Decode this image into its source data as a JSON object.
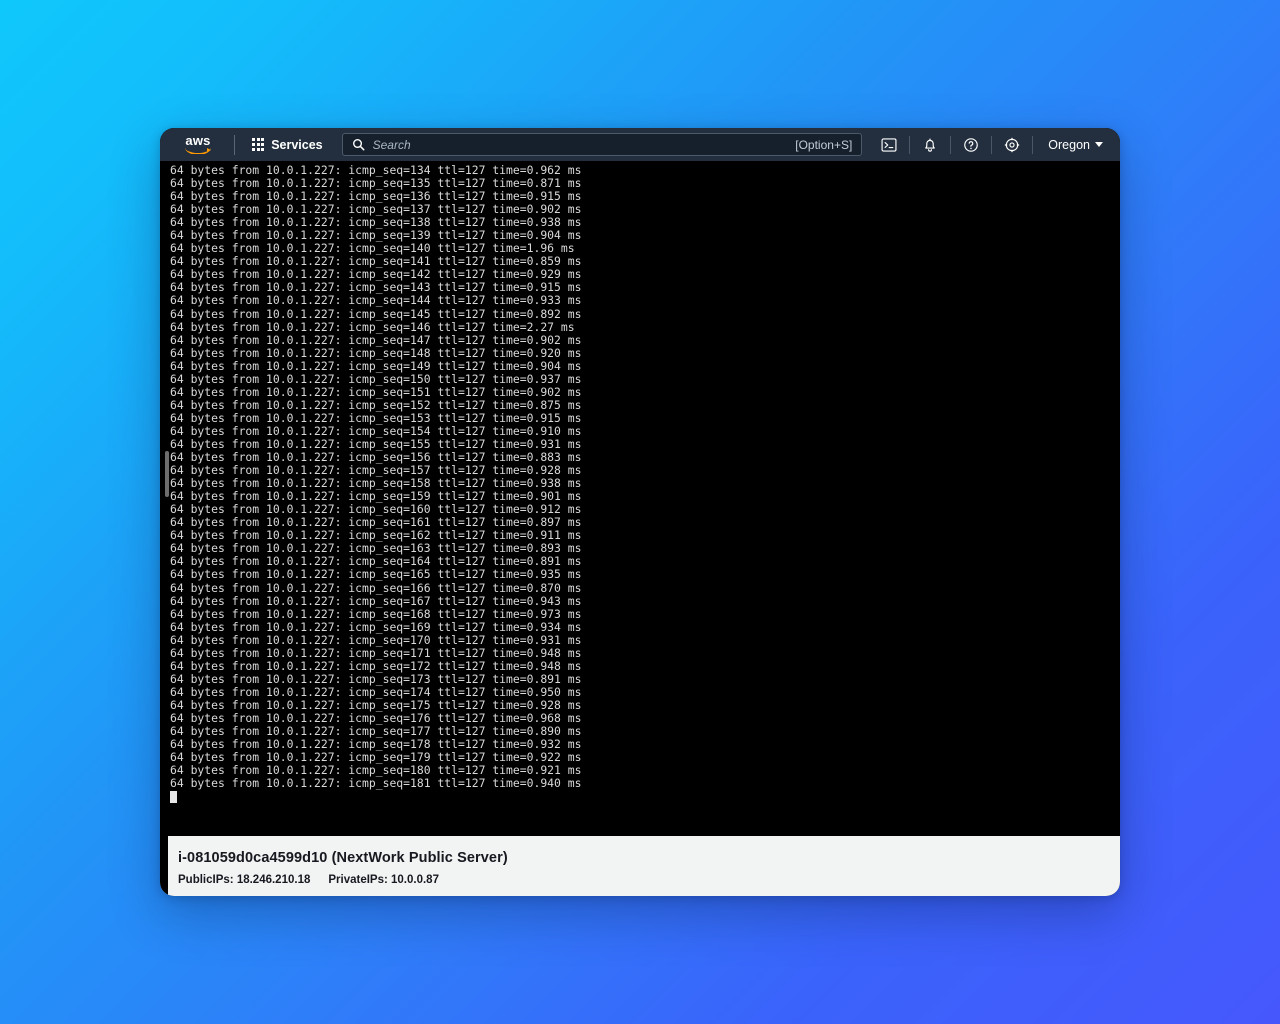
{
  "topnav": {
    "logo_text": "aws",
    "services_label": "Services",
    "search": {
      "placeholder": "Search",
      "value": "",
      "shortcut": "[Option+S]"
    },
    "icons": [
      {
        "name": "cloudshell-icon",
        "title": "CloudShell"
      },
      {
        "name": "notifications-bell-icon",
        "title": "Notifications"
      },
      {
        "name": "help-question-icon",
        "title": "Help"
      },
      {
        "name": "settings-gear-icon",
        "title": "Settings"
      }
    ],
    "region_label": "Oregon",
    "colors": {
      "nav_background": "#232f3e",
      "logo_accent": "#ff9900"
    }
  },
  "terminal": {
    "prompt_cursor": true,
    "lines": [
      "64 bytes from 10.0.1.227: icmp_seq=134 ttl=127 time=0.962 ms",
      "64 bytes from 10.0.1.227: icmp_seq=135 ttl=127 time=0.871 ms",
      "64 bytes from 10.0.1.227: icmp_seq=136 ttl=127 time=0.915 ms",
      "64 bytes from 10.0.1.227: icmp_seq=137 ttl=127 time=0.902 ms",
      "64 bytes from 10.0.1.227: icmp_seq=138 ttl=127 time=0.938 ms",
      "64 bytes from 10.0.1.227: icmp_seq=139 ttl=127 time=0.904 ms",
      "64 bytes from 10.0.1.227: icmp_seq=140 ttl=127 time=1.96 ms",
      "64 bytes from 10.0.1.227: icmp_seq=141 ttl=127 time=0.859 ms",
      "64 bytes from 10.0.1.227: icmp_seq=142 ttl=127 time=0.929 ms",
      "64 bytes from 10.0.1.227: icmp_seq=143 ttl=127 time=0.915 ms",
      "64 bytes from 10.0.1.227: icmp_seq=144 ttl=127 time=0.933 ms",
      "64 bytes from 10.0.1.227: icmp_seq=145 ttl=127 time=0.892 ms",
      "64 bytes from 10.0.1.227: icmp_seq=146 ttl=127 time=2.27 ms",
      "64 bytes from 10.0.1.227: icmp_seq=147 ttl=127 time=0.902 ms",
      "64 bytes from 10.0.1.227: icmp_seq=148 ttl=127 time=0.920 ms",
      "64 bytes from 10.0.1.227: icmp_seq=149 ttl=127 time=0.904 ms",
      "64 bytes from 10.0.1.227: icmp_seq=150 ttl=127 time=0.937 ms",
      "64 bytes from 10.0.1.227: icmp_seq=151 ttl=127 time=0.902 ms",
      "64 bytes from 10.0.1.227: icmp_seq=152 ttl=127 time=0.875 ms",
      "64 bytes from 10.0.1.227: icmp_seq=153 ttl=127 time=0.915 ms",
      "64 bytes from 10.0.1.227: icmp_seq=154 ttl=127 time=0.910 ms",
      "64 bytes from 10.0.1.227: icmp_seq=155 ttl=127 time=0.931 ms",
      "64 bytes from 10.0.1.227: icmp_seq=156 ttl=127 time=0.883 ms",
      "64 bytes from 10.0.1.227: icmp_seq=157 ttl=127 time=0.928 ms",
      "64 bytes from 10.0.1.227: icmp_seq=158 ttl=127 time=0.938 ms",
      "64 bytes from 10.0.1.227: icmp_seq=159 ttl=127 time=0.901 ms",
      "64 bytes from 10.0.1.227: icmp_seq=160 ttl=127 time=0.912 ms",
      "64 bytes from 10.0.1.227: icmp_seq=161 ttl=127 time=0.897 ms",
      "64 bytes from 10.0.1.227: icmp_seq=162 ttl=127 time=0.911 ms",
      "64 bytes from 10.0.1.227: icmp_seq=163 ttl=127 time=0.893 ms",
      "64 bytes from 10.0.1.227: icmp_seq=164 ttl=127 time=0.891 ms",
      "64 bytes from 10.0.1.227: icmp_seq=165 ttl=127 time=0.935 ms",
      "64 bytes from 10.0.1.227: icmp_seq=166 ttl=127 time=0.870 ms",
      "64 bytes from 10.0.1.227: icmp_seq=167 ttl=127 time=0.943 ms",
      "64 bytes from 10.0.1.227: icmp_seq=168 ttl=127 time=0.973 ms",
      "64 bytes from 10.0.1.227: icmp_seq=169 ttl=127 time=0.934 ms",
      "64 bytes from 10.0.1.227: icmp_seq=170 ttl=127 time=0.931 ms",
      "64 bytes from 10.0.1.227: icmp_seq=171 ttl=127 time=0.948 ms",
      "64 bytes from 10.0.1.227: icmp_seq=172 ttl=127 time=0.948 ms",
      "64 bytes from 10.0.1.227: icmp_seq=173 ttl=127 time=0.891 ms",
      "64 bytes from 10.0.1.227: icmp_seq=174 ttl=127 time=0.950 ms",
      "64 bytes from 10.0.1.227: icmp_seq=175 ttl=127 time=0.928 ms",
      "64 bytes from 10.0.1.227: icmp_seq=176 ttl=127 time=0.968 ms",
      "64 bytes from 10.0.1.227: icmp_seq=177 ttl=127 time=0.890 ms",
      "64 bytes from 10.0.1.227: icmp_seq=178 ttl=127 time=0.932 ms",
      "64 bytes from 10.0.1.227: icmp_seq=179 ttl=127 time=0.922 ms",
      "64 bytes from 10.0.1.227: icmp_seq=180 ttl=127 time=0.921 ms",
      "64 bytes from 10.0.1.227: icmp_seq=181 ttl=127 time=0.940 ms"
    ]
  },
  "instance_info": {
    "title": "i-081059d0ca4599d10 (NextWork Public Server)",
    "public_ips_label": "PublicIPs:",
    "public_ips_value": "18.246.210.18",
    "private_ips_label": "PrivateIPs:",
    "private_ips_value": "10.0.0.87"
  }
}
